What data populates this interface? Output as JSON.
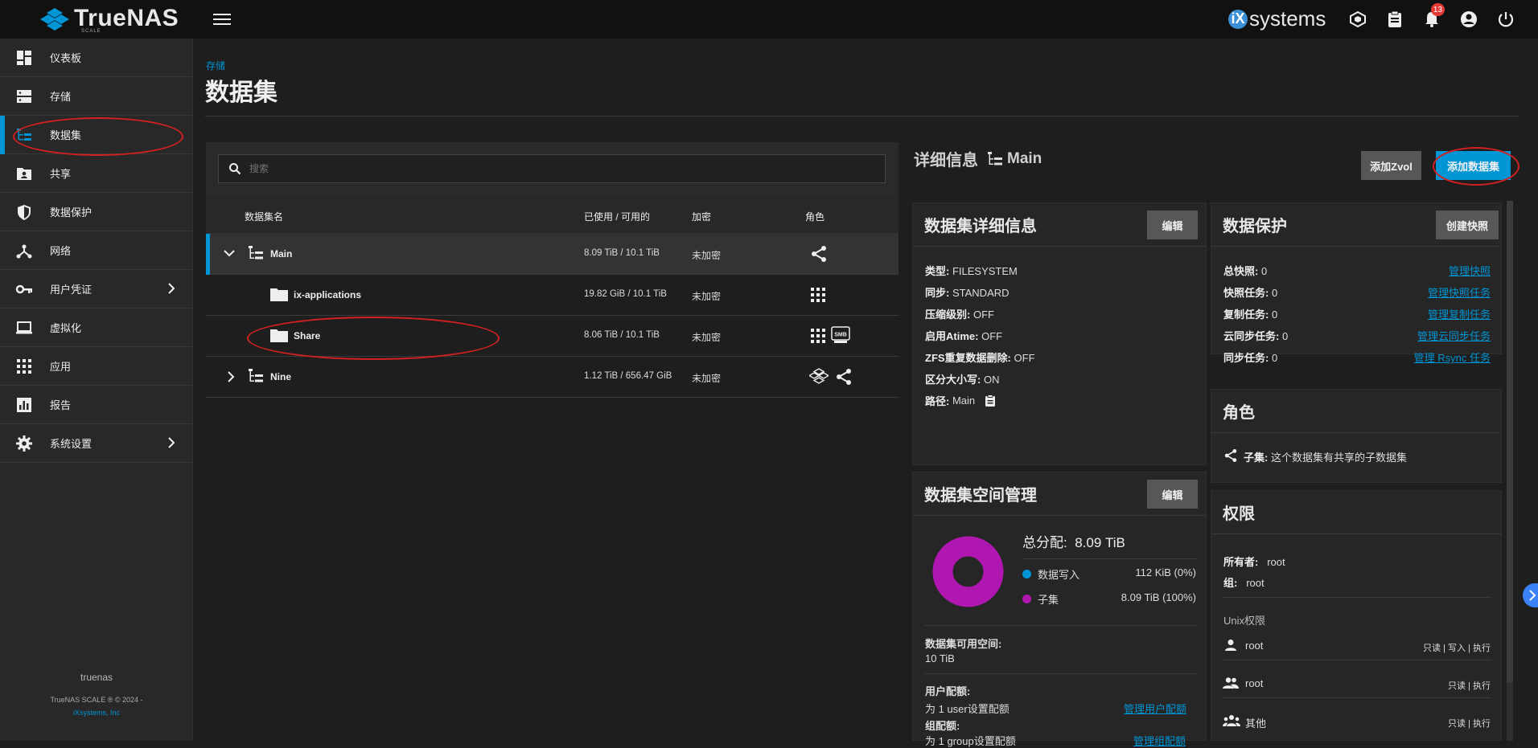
{
  "app": {
    "name": "TrueNAS",
    "edition": "SCALE",
    "vendor": "systems",
    "vendor_prefix": "iX",
    "notifications": "13"
  },
  "sidebar": {
    "items": [
      {
        "label": "仪表板",
        "icon": "dashboard-icon"
      },
      {
        "label": "存储",
        "icon": "storage-icon"
      },
      {
        "label": "数据集",
        "icon": "dataset-icon"
      },
      {
        "label": "共享",
        "icon": "shares-icon"
      },
      {
        "label": "数据保护",
        "icon": "shield-icon"
      },
      {
        "label": "网络",
        "icon": "network-icon"
      },
      {
        "label": "用户凭证",
        "icon": "key-icon"
      },
      {
        "label": "虚拟化",
        "icon": "laptop-icon"
      },
      {
        "label": "应用",
        "icon": "apps-icon"
      },
      {
        "label": "报告",
        "icon": "report-icon"
      },
      {
        "label": "系统设置",
        "icon": "gear-icon"
      }
    ],
    "footer_host": "truenas",
    "footer_copy": "TrueNAS SCALE ® © 2024 -",
    "footer_link": "iXsystems, Inc"
  },
  "page": {
    "breadcrumb": "存储",
    "title": "数据集"
  },
  "search": {
    "placeholder": "搜索"
  },
  "table": {
    "headers": {
      "name": "数据集名",
      "used": "已使用 / 可用的",
      "enc": "加密",
      "roles": "角色"
    },
    "rows": [
      {
        "name": "Main",
        "used": "8.09 TiB / 10.1 TiB",
        "enc": "未加密"
      },
      {
        "name": "ix-applications",
        "used": "19.82 GiB / 10.1 TiB",
        "enc": "未加密"
      },
      {
        "name": "Share",
        "used": "8.06 TiB / 10.1 TiB",
        "enc": "未加密"
      },
      {
        "name": "Nine",
        "used": "1.12 TiB / 656.47 GiB",
        "enc": "未加密"
      }
    ]
  },
  "details": {
    "title": "详细信息",
    "name": "Main",
    "add_zvol": "添加Zvol",
    "add_dataset": "添加数据集",
    "ds_card": {
      "title": "数据集详细信息",
      "edit": "编辑",
      "fields": [
        {
          "k": "类型:",
          "v": "FILESYSTEM"
        },
        {
          "k": "同步:",
          "v": "STANDARD"
        },
        {
          "k": "压缩级别:",
          "v": "OFF"
        },
        {
          "k": "启用Atime:",
          "v": "OFF"
        },
        {
          "k": "ZFS重复数据删除:",
          "v": "OFF"
        },
        {
          "k": "区分大小写:",
          "v": "ON"
        },
        {
          "k": "路径:",
          "v": "Main"
        }
      ]
    },
    "space_card": {
      "title": "数据集空间管理",
      "edit": "编辑",
      "total_label": "总分配:",
      "total_value": "8.09 TiB",
      "legend": [
        {
          "label": "数据写入",
          "value": "112 KiB (0%)",
          "color": "#0095d5",
          "fraction": 0.0
        },
        {
          "label": "子集",
          "value": "8.09 TiB (100%)",
          "color": "#b017b0",
          "fraction": 1.0
        }
      ],
      "avail_label": "数据集可用空间:",
      "avail_value": "10 TiB",
      "user_quota_label": "用户配额:",
      "user_quota_value": "为 1 user设置配额",
      "user_quota_link": "管理用户配额",
      "group_quota_label": "组配额:",
      "group_quota_value": "为 1 group设置配额",
      "group_quota_link": "管理组配额"
    },
    "protect_card": {
      "title": "数据保护",
      "create": "创建快照",
      "rows": [
        {
          "k": "总快照:",
          "v": "0",
          "link": "管理快照"
        },
        {
          "k": "快照任务:",
          "v": "0",
          "link": "管理快照任务"
        },
        {
          "k": "复制任务:",
          "v": "0",
          "link": "管理复制任务"
        },
        {
          "k": "云同步任务:",
          "v": "0",
          "link": "管理云同步任务"
        },
        {
          "k": "同步任务:",
          "v": "0",
          "link": "管理 Rsync 任务"
        }
      ]
    },
    "roles_card": {
      "title": "角色",
      "key": "子集:",
      "text": "这个数据集有共享的子数据集"
    },
    "perm_card": {
      "title": "权限",
      "owner_label": "所有者:",
      "owner": "root",
      "group_label": "组:",
      "group": "root",
      "unix": "Unix权限",
      "entries": [
        {
          "name": "root",
          "perm": "只读 | 写入 | 执行",
          "icon": "user-icon"
        },
        {
          "name": "root",
          "perm": "只读 | 执行",
          "icon": "group-icon"
        },
        {
          "name": "其他",
          "perm": "只读 | 执行",
          "icon": "others-icon"
        }
      ]
    }
  }
}
